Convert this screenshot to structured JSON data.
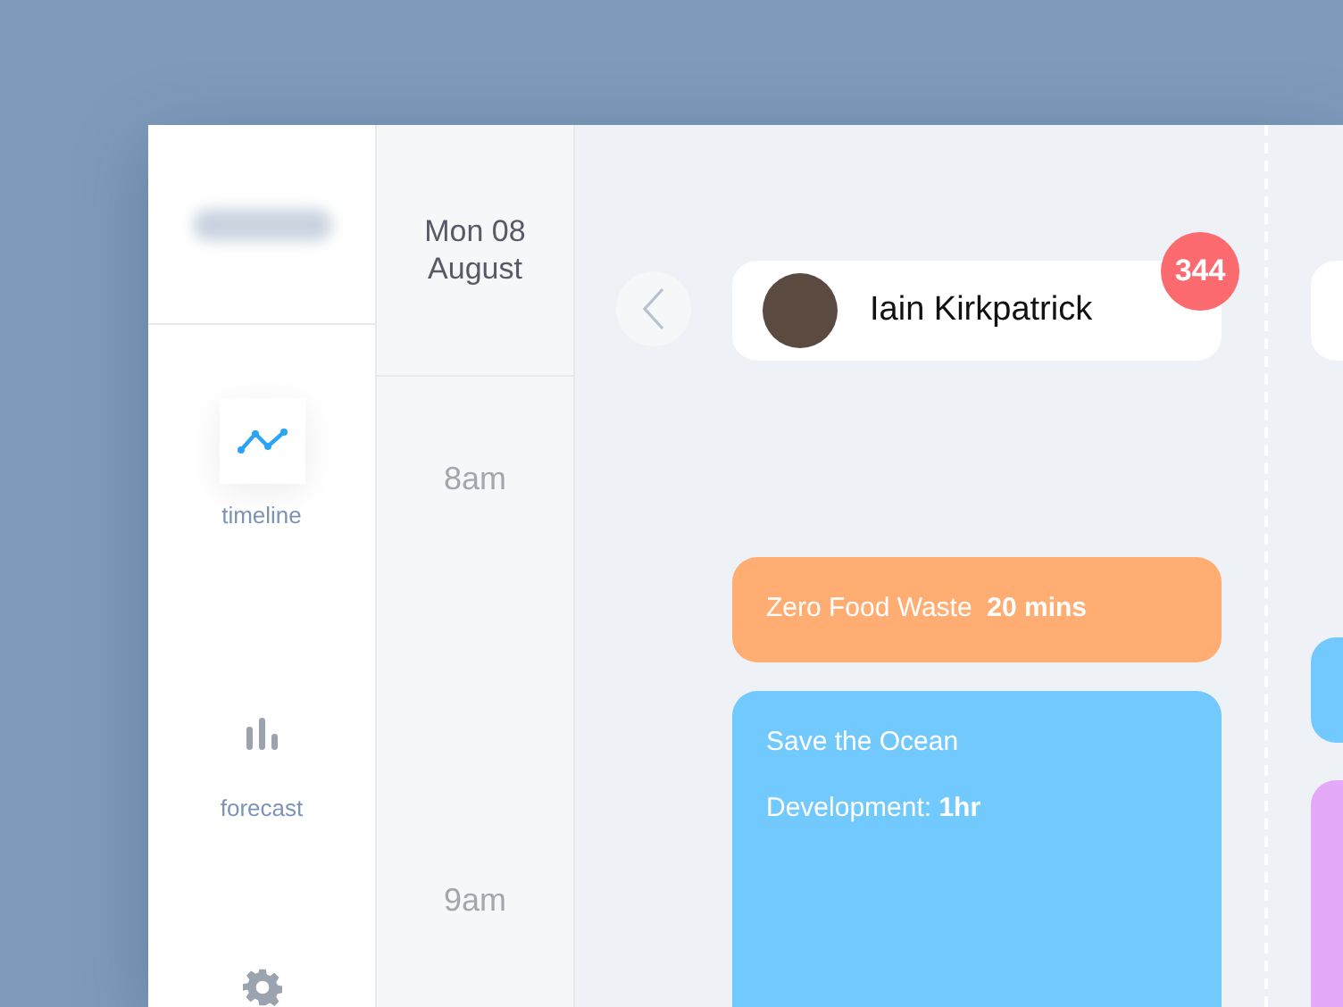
{
  "sidebar": {
    "items": [
      {
        "label": "timeline",
        "kind": "line",
        "selected": true
      },
      {
        "label": "forecast",
        "kind": "bars",
        "selected": false
      }
    ]
  },
  "date": "Mon 08 August",
  "times": [
    "8am",
    "9am"
  ],
  "columns": [
    {
      "person": "Iain Kirkpatrick",
      "badge": "344",
      "events": [
        {
          "color": "#ffad72",
          "lines": [
            "Zero Food Waste  **20 mins**"
          ]
        },
        {
          "color": "#72c9fd",
          "lines": [
            "Save the Ocean",
            "Development: **1hr**"
          ]
        }
      ]
    },
    {
      "events": [
        {
          "color": "#72c9fd"
        },
        {
          "color": "#e4a9f9"
        }
      ]
    }
  ]
}
